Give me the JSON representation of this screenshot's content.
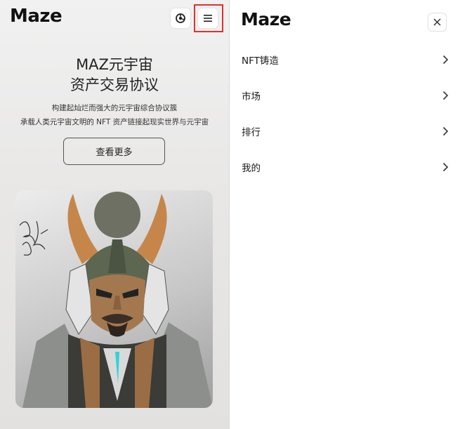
{
  "brand": {
    "logo": "Maze"
  },
  "hero": {
    "title_line1": "MAZ元宇宙",
    "title_line2": "资产交易协议",
    "subtitle_line1": "构建起灿烂而强大的元宇宙综合协议簇",
    "subtitle_line2": "承载人类元宇宙文明的 NFT 资产链接起现实世界与元宇宙",
    "cta_label": "查看更多"
  },
  "menu_panel": {
    "logo": "Maze",
    "items": [
      {
        "label": "NFT铸造"
      },
      {
        "label": "市场"
      },
      {
        "label": "排行"
      },
      {
        "label": "我的"
      }
    ]
  },
  "icons": {
    "wallet": "wallet-icon",
    "menu": "hamburger-menu-icon",
    "close": "close-icon",
    "chevron": "chevron-right-icon"
  },
  "colors": {
    "highlight": "#e0312d",
    "text": "#1a1a1a",
    "background": "#ffffff"
  }
}
